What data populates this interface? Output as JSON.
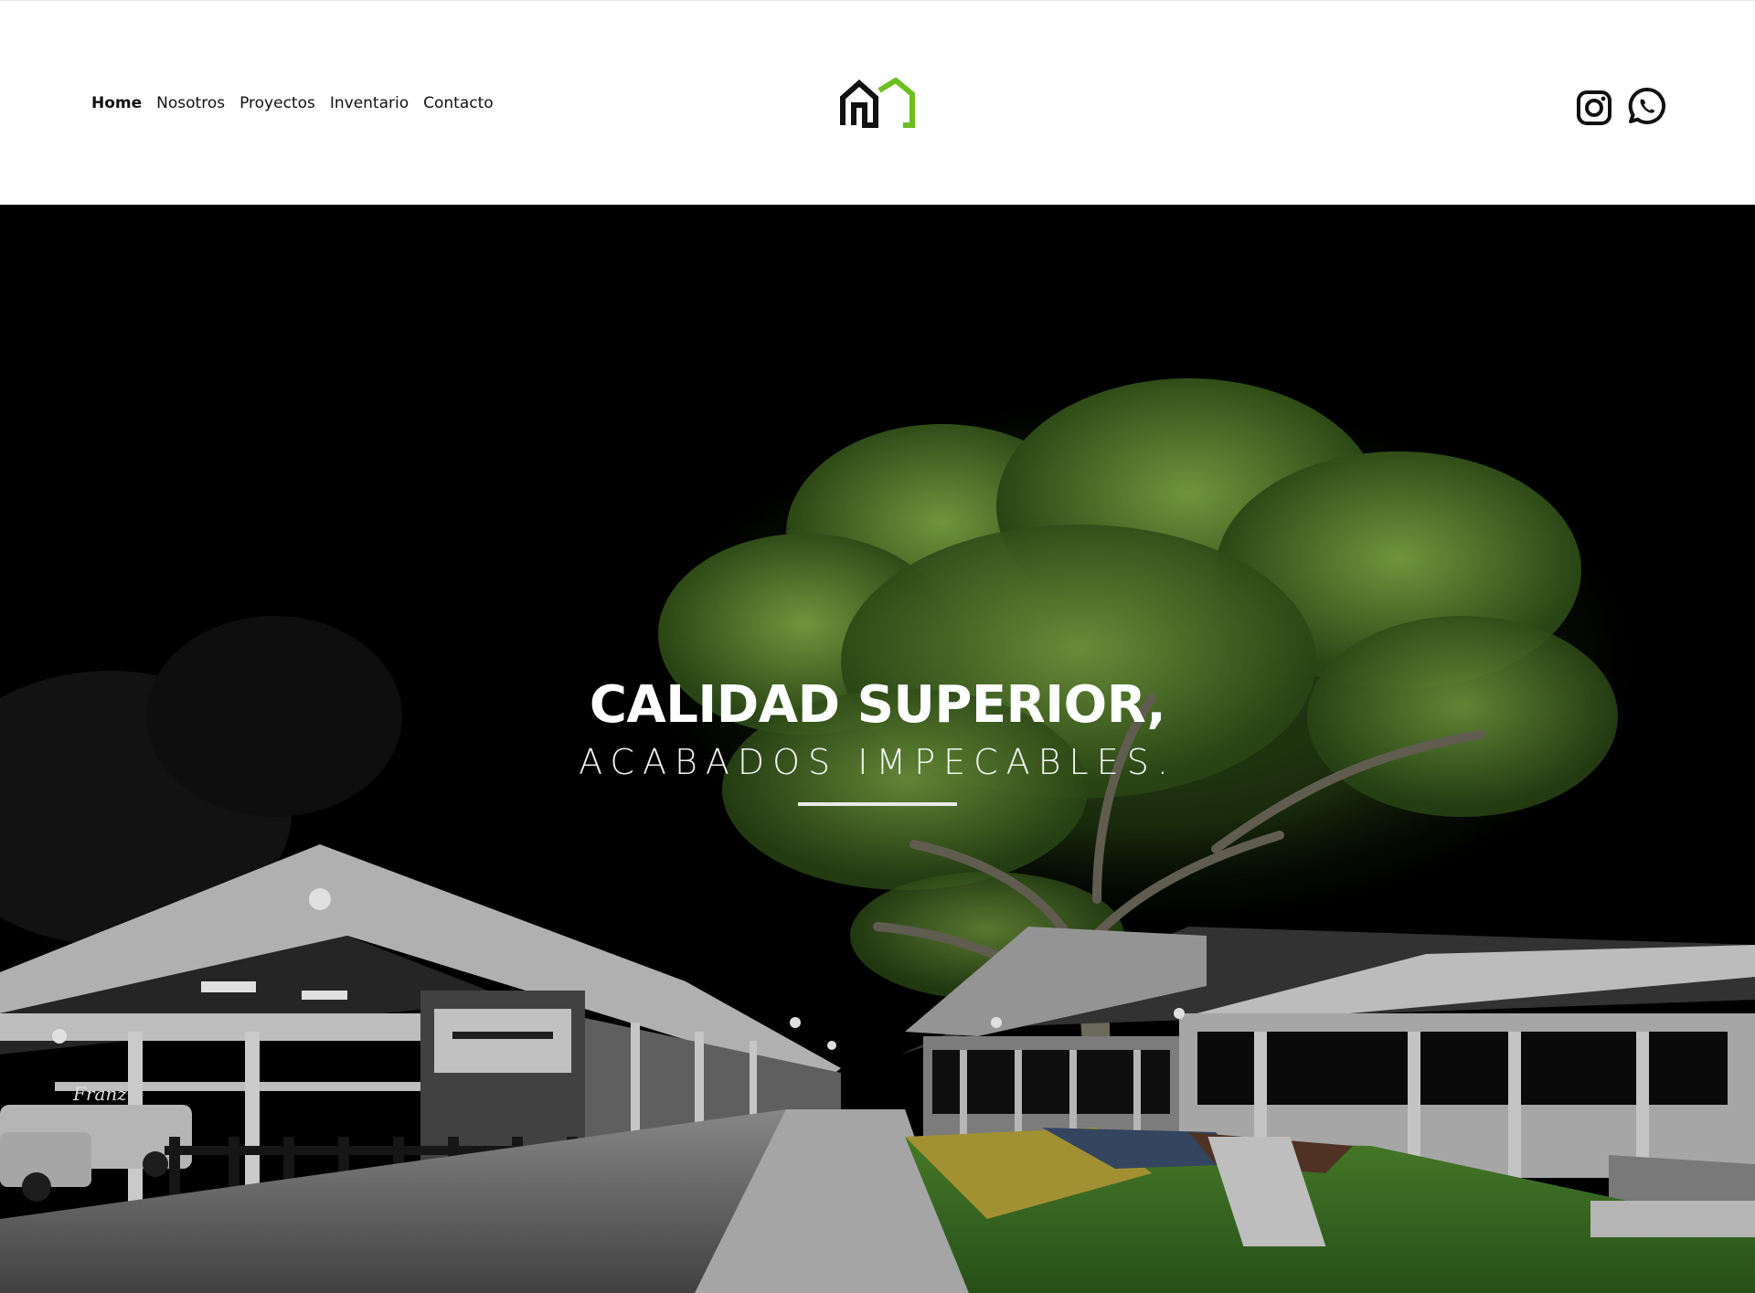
{
  "nav": {
    "items": [
      {
        "label": "Home",
        "active": true
      },
      {
        "label": "Nosotros"
      },
      {
        "label": "Proyectos"
      },
      {
        "label": "Inventario"
      },
      {
        "label": "Contacto"
      }
    ]
  },
  "brand": {
    "logo_icon": "house-logo",
    "accent": "#6bbf1f",
    "dark": "#111111"
  },
  "social": {
    "instagram_icon": "instagram-icon",
    "whatsapp_icon": "whatsapp-icon"
  },
  "hero": {
    "headline": "CALIDAD SUPERIOR,",
    "subline": "ACABADOS IMPECABLES.",
    "sign_text": "Franz"
  }
}
